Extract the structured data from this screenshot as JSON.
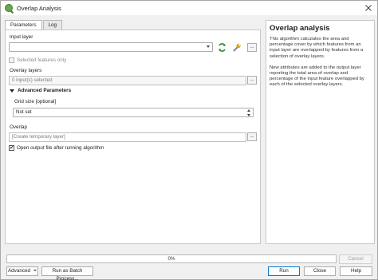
{
  "window": {
    "title": "Overlap Analysis",
    "app_icon": "qgis-icon"
  },
  "tabs": [
    {
      "label": "Parameters",
      "active": true
    },
    {
      "label": "Log",
      "active": false
    }
  ],
  "parameters": {
    "input_layer_label": "Input layer",
    "input_layer_value": "",
    "selected_features_label": "Selected features only",
    "selected_features_checked": false,
    "overlay_layers_label": "Overlay layers",
    "overlay_layers_value": "0 input(s) selected",
    "advanced_label": "Advanced Parameters",
    "grid_size_label": "Grid size [optional]",
    "grid_size_value": "Not set",
    "overlap_label": "Overlap",
    "overlap_placeholder": "[Create temporary layer]",
    "open_output_label": "Open output file after running algorithm",
    "open_output_checked": true,
    "browse_label": "..."
  },
  "help": {
    "title": "Overlap analysis",
    "paragraphs": [
      "This algorithm calculates the area and percentage cover by which features from an input layer are overlapped by features from a selection of overlay layers.",
      "New attributes are added to the output layer reporting the total area of overlap and percentage of the input feature overlapped by each of the selected overlay layers."
    ]
  },
  "progress": {
    "text": "0%",
    "value": 0
  },
  "buttons": {
    "cancel": "Cancel",
    "advanced": "Advanced",
    "batch": "Run as Batch Process...",
    "run": "Run",
    "close": "Close",
    "help": "Help"
  },
  "colors": {
    "accent": "#0078d7",
    "qgis_green": "#6aa84f",
    "progress_green": "#06b025"
  }
}
